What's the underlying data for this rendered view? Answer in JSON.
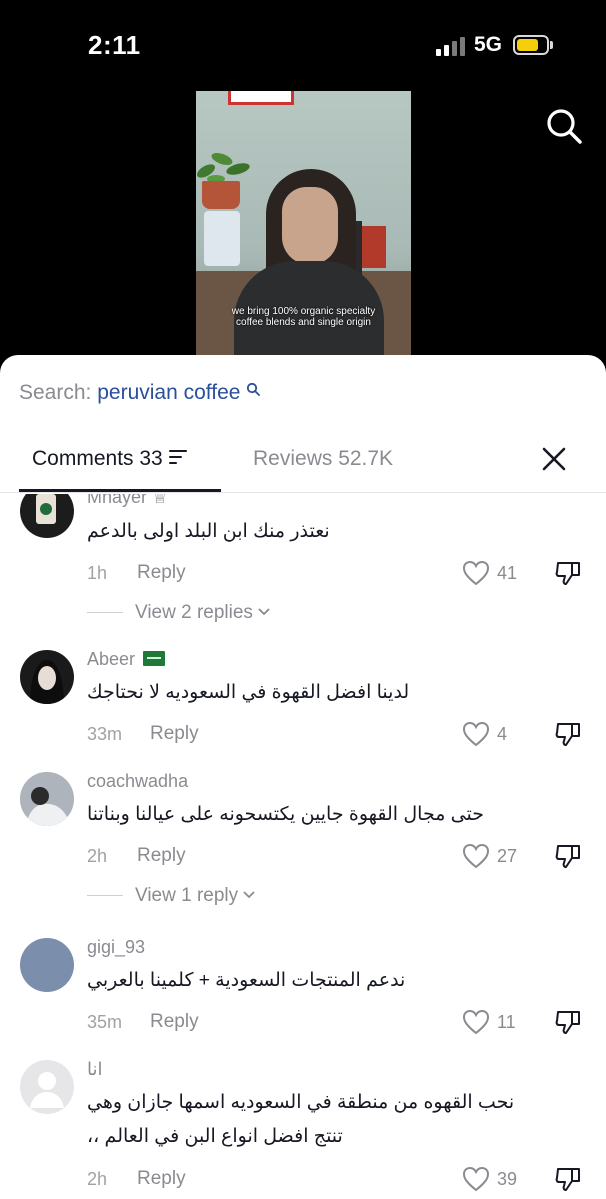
{
  "status_bar": {
    "time": "2:11",
    "network": "5G",
    "battery_color": "#f5cf0b"
  },
  "video": {
    "caption": "we bring 100% organic specialty coffee blends and single origin",
    "search_icon": "search-icon"
  },
  "sheet": {
    "search_prefix": "Search:",
    "search_query": "peruvian coffee",
    "tabs": {
      "comments_label": "Comments 33",
      "reviews_label": "Reviews 52.7K"
    },
    "close_icon": "close-icon"
  },
  "comments": [
    {
      "username": "Mnayer ♕",
      "text": "نعتذر منك ابن البلد اولى بالدعم",
      "time": "1h",
      "reply_label": "Reply",
      "likes": "41",
      "view_replies": "View 2 replies"
    },
    {
      "username": "Abeer",
      "text": "لدينا افضل القهوة في السعوديه لا نحتاجك",
      "time": "33m",
      "reply_label": "Reply",
      "likes": "4"
    },
    {
      "username": "coachwadha",
      "text": "حتى مجال القهوة جايين يكتسحونه على عيالنا وبناتنا",
      "time": "2h",
      "reply_label": "Reply",
      "likes": "27",
      "view_replies": "View 1 reply"
    },
    {
      "username": "gigi_93",
      "text": "ندعم المنتجات السعودية + كلمينا بالعربي",
      "time": "35m",
      "reply_label": "Reply",
      "likes": "11"
    },
    {
      "username": "انا",
      "text": "نحب القهوه من منطقة في السعوديه اسمها جازان وهي تنتج افضل انواع البن في العالم ،،",
      "time": "2h",
      "reply_label": "Reply",
      "likes": "39"
    }
  ]
}
